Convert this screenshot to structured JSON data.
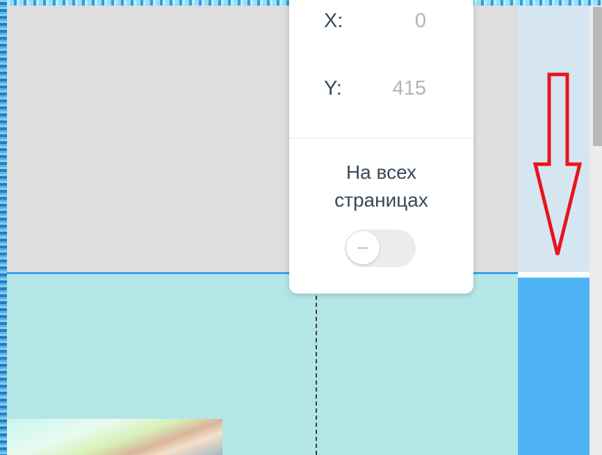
{
  "position_panel": {
    "x_label": "X:",
    "x_value": "0",
    "y_label": "Y:",
    "y_value": "415",
    "all_pages_label_line1": "На всех",
    "all_pages_label_line2": "страницах",
    "all_pages_toggle": "off"
  },
  "annotation": {
    "arrow_color": "#e8141c",
    "arrow_direction": "down"
  },
  "colors": {
    "canvas_background": "#dedede",
    "section_background": "#b4e6e8",
    "section_border": "#3aa3e8",
    "panel_text": "#3a4856",
    "panel_value": "#b3b3b3"
  }
}
